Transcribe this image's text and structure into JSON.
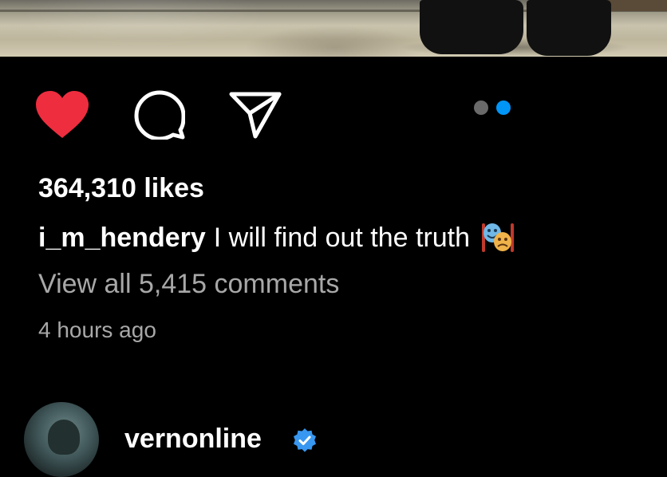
{
  "post": {
    "likes_text": "364,310 likes",
    "caption_username": "i_m_hendery",
    "caption_text": "I will find out the truth",
    "caption_emoji_icon": "performing-arts-masks-icon",
    "view_comments_text": "View all 5,415 comments",
    "timestamp": "4 hours ago",
    "carousel": {
      "total": 2,
      "active_index": 1
    }
  },
  "actions": {
    "like_icon": "heart-icon",
    "comment_icon": "comment-bubble-icon",
    "share_icon": "paper-plane-icon",
    "liked": true
  },
  "next_post": {
    "username": "vernonline",
    "verified": true,
    "verified_icon": "verified-badge-icon"
  },
  "colors": {
    "background": "#000000",
    "like_red": "#ee2d3f",
    "text_primary": "#ffffff",
    "text_secondary": "#a8a8a8",
    "dot_inactive": "#6a6a6a",
    "dot_active": "#0095f6",
    "verified_blue": "#3897f0"
  }
}
